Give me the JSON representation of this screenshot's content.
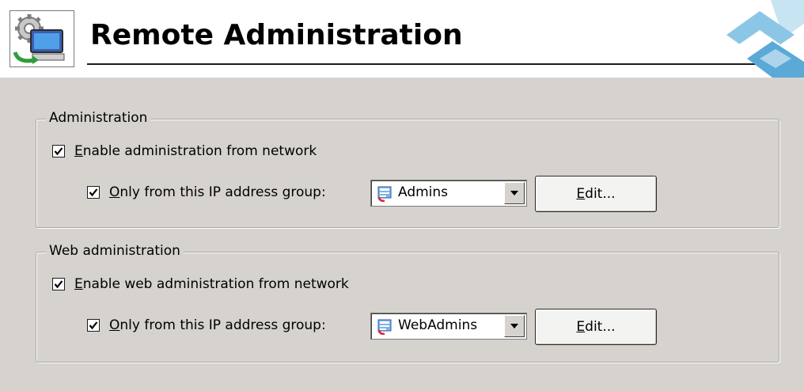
{
  "header": {
    "title": "Remote Administration",
    "icon": "remote-admin-computer-icon",
    "logo": "brand-logo-icon"
  },
  "administration": {
    "group_label": "Administration",
    "enable_label": "Enable administration from network",
    "enable_checked": true,
    "only_from_label": "Only from this IP address group:",
    "only_from_checked": true,
    "ip_group_value": "Admins",
    "edit_label": "Edit..."
  },
  "web_administration": {
    "group_label": "Web administration",
    "enable_label": "Enable web administration from network",
    "enable_checked": true,
    "only_from_label": "Only from this IP address group:",
    "only_from_checked": true,
    "ip_group_value": "WebAdmins",
    "edit_label": "Edit..."
  },
  "colors": {
    "panel_bg": "#d6d3ce",
    "header_bg": "#ffffff",
    "logo_blue": "#5aa9d6"
  }
}
